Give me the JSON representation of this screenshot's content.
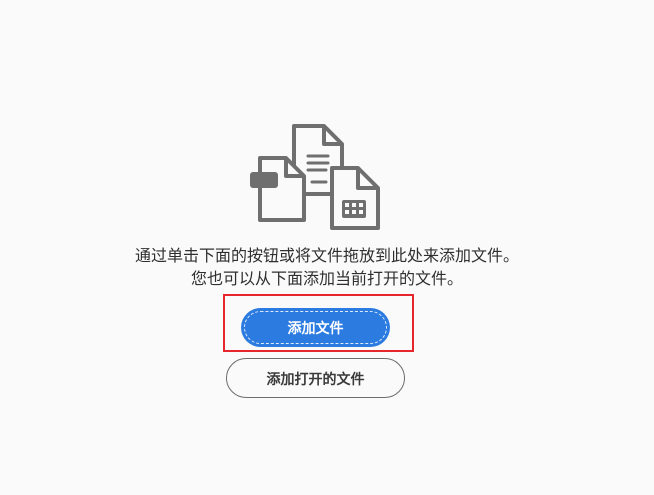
{
  "illustration": {
    "icon": "multiple-files-icon",
    "stroke_color": "#6f6f6f"
  },
  "instructions": {
    "line1": "通过单击下面的按钮或将文件拖放到此处来添加文件。",
    "line2": "您也可以从下面添加当前打开的文件。"
  },
  "buttons": {
    "add_files_label": "添加文件",
    "add_open_files_label": "添加打开的文件"
  },
  "colors": {
    "primary": "#2c7be0",
    "highlight": "#e5262d",
    "background": "#fafafa"
  }
}
